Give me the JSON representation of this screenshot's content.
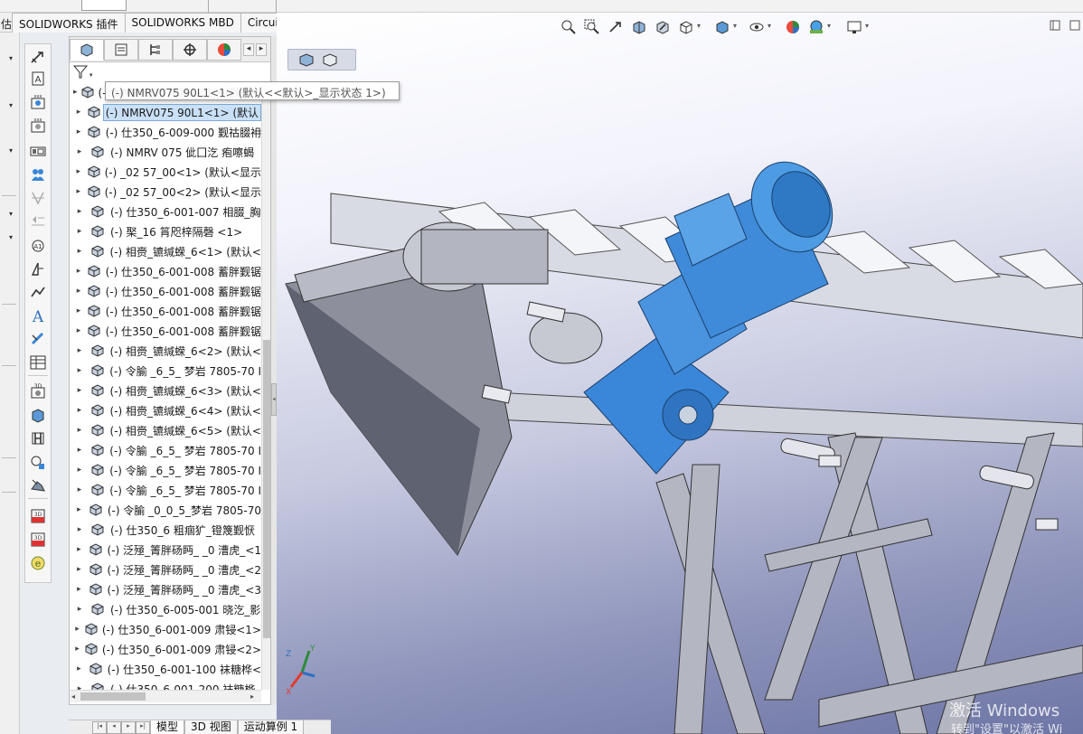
{
  "colors": {
    "machine_blue": "#3a86d8",
    "frame_grey": "#c7c9d3",
    "selection": "#c9e0f7"
  },
  "left_strip": {
    "label": "估"
  },
  "addin_tabs": [
    "SOLIDWORKS 插件",
    "SOLIDWORKS MBD",
    "CircuitWorks"
  ],
  "vertical_toolbar": [
    "smart-dimension-icon",
    "note-icon",
    "balloon-icon",
    "auto-balloon-icon",
    "view-palette-icon",
    "magnetic-line-icon",
    "surface-finish-icon",
    "weld-symbol-icon",
    "hole-callout-icon",
    "datum-target-icon",
    "text-icon",
    "cosmetic-thread-icon",
    "table-icon",
    "model-view-icon",
    "projected-view-icon",
    "section-view-icon",
    "detail-view-icon",
    "broken-view-icon",
    "3d-pdf-icon",
    "publish-pdf-icon",
    "edrawings-icon"
  ],
  "tree_panel": {
    "tabs": [
      "featuremanager-tab",
      "propertymanager-tab",
      "configurationmanager-tab",
      "dimxpert-tab",
      "display-manager-tab"
    ],
    "rows": [
      {
        "label": "(-) NMRV075 90L1<1> (默认<<默认>_显示状态 1>)",
        "selected": false
      },
      {
        "label": "(-) NMRV075 90L1<1> (默认",
        "selected": true
      },
      {
        "label": "(-) 仕350_6-009-000 觐祜腏衻",
        "selected": false
      },
      {
        "label": "(-) NMRV 075 佌囗汔 疱嚓蝎",
        "selected": false
      },
      {
        "label": "(-) _02 57_00<1> (默认<显示",
        "selected": false
      },
      {
        "label": "(-) _02 57_00<2> (默认<显示",
        "selected": false
      },
      {
        "label": "(-) 仕350_6-001-007 相腏_胸",
        "selected": false
      },
      {
        "label": "(-)     棸_16 筲咫梓隔磬   <1>",
        "selected": false
      },
      {
        "label": "(-) 相赍_镳缄蝾_6<1> (默认<",
        "selected": false
      },
      {
        "label": "(-) 仕350_6-001-008 蓄胖觐锯",
        "selected": false
      },
      {
        "label": "(-) 仕350_6-001-008 蓄胖觐锯",
        "selected": false
      },
      {
        "label": "(-) 仕350_6-001-008 蓄胖觐锯",
        "selected": false
      },
      {
        "label": "(-) 仕350_6-001-008 蓄胖觐锯",
        "selected": false
      },
      {
        "label": "(-) 相赍_镳缄蝾_6<2> (默认<",
        "selected": false
      },
      {
        "label": "(-) 令腧 _6_5_ 梦岩 7805-70 I",
        "selected": false
      },
      {
        "label": "(-) 相赍_镳缄蝾_6<3> (默认<",
        "selected": false
      },
      {
        "label": "(-) 相赍_镳缄蝾_6<4> (默认<",
        "selected": false
      },
      {
        "label": "(-) 相赍_镳缄蝾_6<5> (默认<",
        "selected": false
      },
      {
        "label": "(-) 令腧 _6_5_ 梦岩 7805-70 I",
        "selected": false
      },
      {
        "label": "(-) 令腧 _6_5_ 梦岩 7805-70 I",
        "selected": false
      },
      {
        "label": "(-) 令腧 _6_5_ 梦岩 7805-70 I",
        "selected": false
      },
      {
        "label": "(-) 令腧 _0_0_5_梦岩 7805-70",
        "selected": false
      },
      {
        "label": "(-) 仕350_6 粗痼犷_镫篾觐恹",
        "selected": false
      },
      {
        "label": "(-) 泛殛_箐胖砀眄_ _0 漕虎_<1",
        "selected": false
      },
      {
        "label": "(-) 泛殛_箐胖砀眄_ _0 漕虎_<2",
        "selected": false
      },
      {
        "label": "(-) 泛殛_箐胖砀眄_ _0 漕虎_<3",
        "selected": false
      },
      {
        "label": "(-) 仕350_6-005-001 晓汔_影",
        "selected": false
      },
      {
        "label": "(-) 仕350_6-001-009 肃锓<1>",
        "selected": false
      },
      {
        "label": "(-) 仕350_6-001-009 肃锓<2>",
        "selected": false
      },
      {
        "label": "(-) 仕350_6-001-100 袜糖桦<",
        "selected": false
      },
      {
        "label": "(-) 仕350_6-001-200 袜糖桦",
        "selected": false
      }
    ]
  },
  "tooltip": {
    "text": "(-) NMRV075 90L1<1> (默认<<默认>_显示状态 1>)"
  },
  "hud_toolbar": [
    "zoom-to-fit-icon",
    "zoom-to-area-icon",
    "previous-view-icon",
    "section-view-icon",
    "dynamic-annotation-icon",
    "view-orientation-icon",
    "display-style-icon",
    "hide-show-items-icon",
    "edit-appearance-icon",
    "apply-scene-icon",
    "view-settings-icon"
  ],
  "bottom_tabs": [
    "模型",
    "3D 视图",
    "运动算例 1"
  ],
  "watermark": {
    "line1": "激活 Windows",
    "line2": "转到\"设置\"以激活 Wi"
  }
}
